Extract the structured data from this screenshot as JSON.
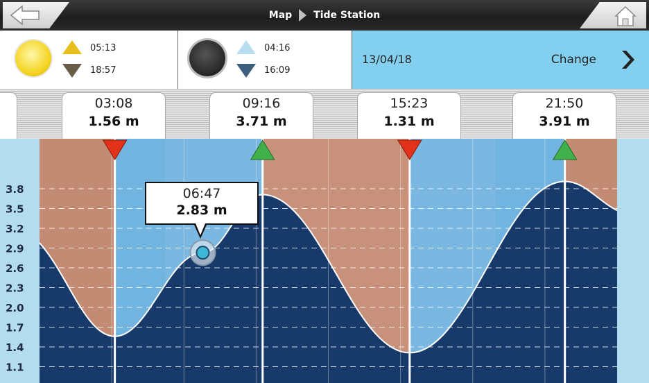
{
  "header": {
    "breadcrumbs": [
      "Map",
      "Tide Station"
    ]
  },
  "sun": {
    "rise": "05:13",
    "set": "18:57"
  },
  "moon": {
    "rise": "04:16",
    "set": "16:09"
  },
  "date_panel": {
    "date": "13/04/18",
    "change_label": "Change"
  },
  "tides": [
    {
      "time": "03:08",
      "height": "1.56 m",
      "type": "low"
    },
    {
      "time": "09:16",
      "height": "3.71 m",
      "type": "high"
    },
    {
      "time": "15:23",
      "height": "1.31 m",
      "type": "low"
    },
    {
      "time": "21:50",
      "height": "3.91 m",
      "type": "high"
    }
  ],
  "cursor": {
    "time": "06:47",
    "height": "2.83 m"
  },
  "colors": {
    "water": "#173a6b",
    "sky_light": "#72b4e0",
    "sky_tan": "#c48b74",
    "high_marker": "#3fb04a",
    "low_marker": "#e2321a",
    "date_panel": "#82cff0"
  },
  "chart_data": {
    "type": "area",
    "y_ticks": [
      "3.8",
      "3.5",
      "3.2",
      "2.9",
      "2.6",
      "2.3",
      "2.0",
      "1.7",
      "1.4",
      "1.1"
    ],
    "ylim": [
      0.9,
      4.0
    ],
    "points": [
      {
        "x": 0.0,
        "y": 2.98
      },
      {
        "x": 3.13,
        "y": 1.56
      },
      {
        "x": 6.78,
        "y": 2.83
      },
      {
        "x": 9.27,
        "y": 3.71
      },
      {
        "x": 15.38,
        "y": 1.31
      },
      {
        "x": 21.83,
        "y": 3.91
      },
      {
        "x": 24.0,
        "y": 3.47
      }
    ]
  }
}
